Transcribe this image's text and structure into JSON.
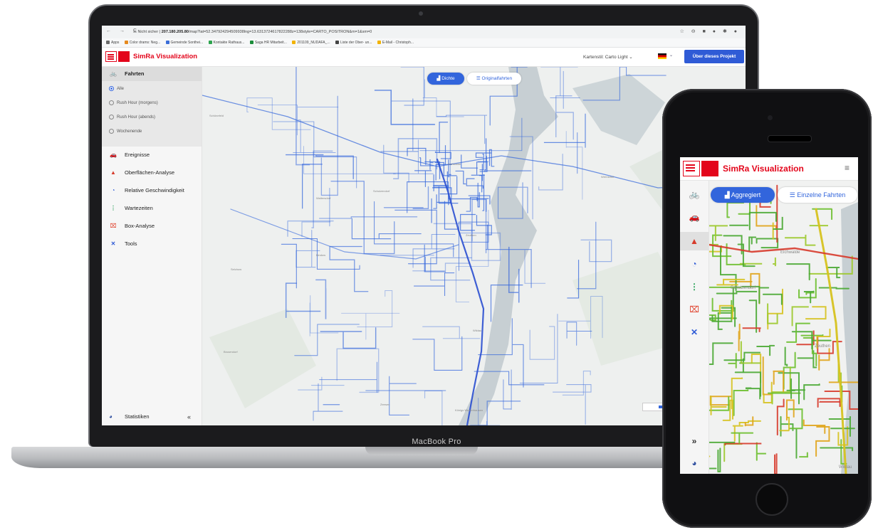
{
  "laptop": {
    "brand": "MacBook Pro",
    "browser": {
      "nav": "← → C",
      "security": "⚠ Nicht sicher",
      "host": "207.180.205.80",
      "path": "/map?lat=52.347924294509938lng=13.6313724617822288z=138style=CARTO_POSITRON&m=1&sm=0",
      "extensions": "☆ ⊖ ■ ● ✱ ●",
      "bookmarks": [
        "Apps",
        "Color drams: Neg...",
        "Gemeinde Sonthei...",
        "Kontakte Rathaus...",
        "Saga HR Mitarbeit...",
        "201109_NUDAFA_...",
        "Liste der Ober- un...",
        "E-Mail - Christoph..."
      ]
    },
    "app": {
      "title": "SimRa Visualization",
      "map_style": "Kartenstil: Carto Light ⌄",
      "lang_chevron": "⌄",
      "about_button": "Über dieses Projekt"
    },
    "sidebar": {
      "items": [
        {
          "label": "Fahrten",
          "icon": "🚲"
        },
        {
          "label": "Ereignisse",
          "icon": "🚗"
        },
        {
          "label": "Oberflächen-Analyse",
          "icon": "▲"
        },
        {
          "label": "Relative Geschwindigkeit",
          "icon": "◔"
        },
        {
          "label": "Wartezeiten",
          "icon": "⋮"
        },
        {
          "label": "Box-Analyse",
          "icon": "⌧"
        },
        {
          "label": "Tools",
          "icon": "✕"
        }
      ],
      "filters": [
        "Alle",
        "Rush Hour (morgens)",
        "Rush Hour (abends)",
        "Wochenende"
      ],
      "selected_filter": "Alle",
      "stats_label": "Statistiken",
      "collapse_icon": "«"
    },
    "map": {
      "toggle_a": "Dichte",
      "toggle_b": "Originalfahrten",
      "places": [
        "Schönefeld",
        "Waltersdorf",
        "Schulzendorf",
        "Eichwalde",
        "Zeuthen",
        "Wildau",
        "Königs Wusterhausen",
        "Bindow",
        "Zeesen",
        "Brusendorf",
        "Selchow",
        "Wernsdorf"
      ],
      "colors": {
        "line": "#3265dc"
      }
    }
  },
  "phone": {
    "app_title": "SimRa Visualization",
    "menu_icon": "≡",
    "toggle_a": "Aggregiert",
    "toggle_b": "Einzelne Fahrten",
    "rail_icons": [
      "🚲",
      "🚗",
      "▲",
      "◔",
      "⋮",
      "⌧",
      "✕"
    ],
    "expand_icon": "»",
    "stats_icon": "◕",
    "places": [
      "Schulzendorf",
      "Eichwalde",
      "Zeuthen",
      "Wildau"
    ]
  }
}
